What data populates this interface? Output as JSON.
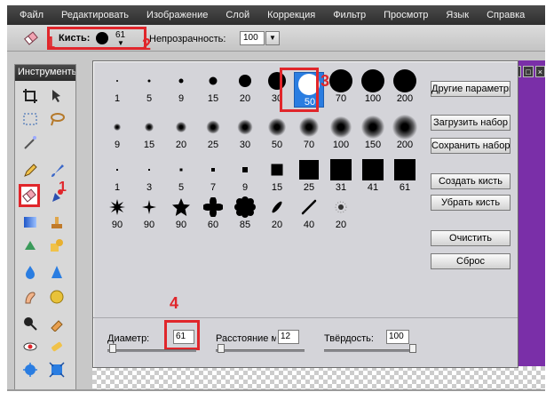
{
  "menu": [
    "Файл",
    "Редактировать",
    "Изображение",
    "Слой",
    "Коррекция",
    "Фильтр",
    "Просмотр",
    "Язык",
    "Справка"
  ],
  "options": {
    "brush_label": "Кисть:",
    "brush_size": "61",
    "opacity_label": "Непрозрачность:",
    "opacity_value": "100"
  },
  "tool_panel": {
    "title": "Инструменты"
  },
  "annotations": {
    "n1": "1",
    "n2": "2",
    "n3": "3",
    "n4": "4"
  },
  "doc_controls": [
    "_",
    "□",
    "×"
  ],
  "brushes": {
    "row1": [
      "1",
      "5",
      "9",
      "15",
      "20",
      "30",
      "50",
      "70",
      "100",
      "200"
    ],
    "row2": [
      "9",
      "15",
      "20",
      "25",
      "30",
      "50",
      "70",
      "100",
      "150",
      "200"
    ],
    "row3": [
      "1",
      "3",
      "5",
      "7",
      "9",
      "15",
      "25",
      "31",
      "41",
      "61"
    ],
    "row4": [
      "90",
      "90",
      "90",
      "60",
      "85",
      "20",
      "40",
      "20"
    ],
    "selected": "50"
  },
  "dialog_buttons": {
    "other_params": "Другие параметры",
    "load_set": "Загрузить набор",
    "save_set": "Сохранить набор",
    "create_brush": "Создать кисть",
    "remove_brush": "Убрать кисть",
    "clear": "Очистить",
    "reset": "Сброс"
  },
  "params": {
    "diameter_label": "Диаметр:",
    "diameter_value": "61",
    "spacing_label": "Расстояние между символами:",
    "spacing_value": "12",
    "hardness_label": "Твёрдость:",
    "hardness_value": "100"
  },
  "colors": {
    "accent_red": "#e0262b",
    "selection_blue": "#2a7de1",
    "canvas_purple": "#7a2fa8"
  }
}
